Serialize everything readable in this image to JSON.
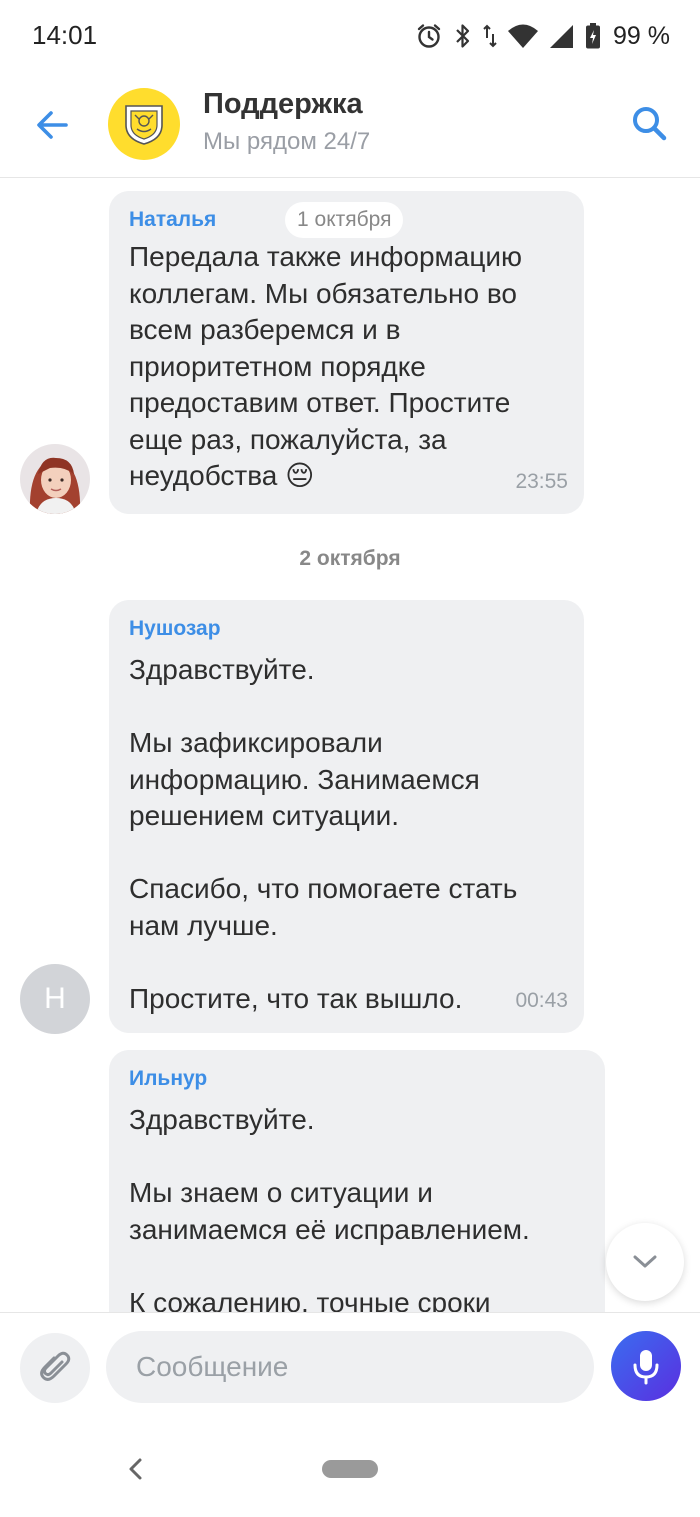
{
  "status_bar": {
    "time": "14:01",
    "battery": "99 %",
    "icons": [
      "alarm-icon",
      "bluetooth-icon",
      "data-arrows-icon",
      "wifi-icon",
      "signal-icon",
      "battery-icon"
    ]
  },
  "header": {
    "title": "Поддержка",
    "subtitle": "Мы рядом 24/7",
    "back_icon": "arrow-left-icon",
    "search_icon": "search-icon",
    "accent_color": "#3d8ee6",
    "logo_color": "#ffdd2d"
  },
  "messages": [
    {
      "author": "Наталья",
      "date_pill": "1 октября",
      "text": "Передала также информацию коллегам. Мы обязательно во всем разберемся и в приоритетном порядке предоставим ответ. Простите еще раз, пожалуйста, за неудобства 😔",
      "time": "23:55",
      "avatar": "photo"
    },
    {
      "author": "Нушозар",
      "text": "Здравствуйте.\n\nМы зафиксировали информацию. Занимаемся решением ситуации.\n\nСпасибо, что помогаете стать нам лучше.\n\nПростите, что так вышло.",
      "time": "00:43",
      "avatar_letter": "Н"
    },
    {
      "author": "Ильнур",
      "text": "Здравствуйте.\n\nМы знаем о ситуации и занимаемся её исправлением.\n\nК сожалению, точные сроки"
    }
  ],
  "date_separator": "2 октября",
  "composer": {
    "placeholder": "Сообщение",
    "attach_icon": "paperclip-icon",
    "mic_icon": "microphone-icon",
    "mic_color": "#4a4ff0"
  },
  "scroll_down_icon": "chevron-down-icon",
  "nav_bar": {
    "back_icon": "nav-back-icon",
    "home_icon": "home-pill-icon"
  }
}
